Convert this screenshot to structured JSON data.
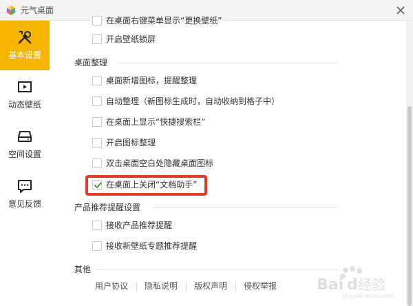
{
  "window": {
    "title": "元气桌面",
    "close_label": "×"
  },
  "sidebar": {
    "items": [
      {
        "label": "基本设置",
        "icon": "tools-icon",
        "active": true
      },
      {
        "label": "动态壁纸",
        "icon": "play-icon",
        "active": false
      },
      {
        "label": "空间设置",
        "icon": "disk-icon",
        "active": false
      },
      {
        "label": "意见反馈",
        "icon": "chat-icon",
        "active": false
      }
    ]
  },
  "main": {
    "top_partial_option": "在桌面右键菜单显示“更换壁纸”",
    "top_option": {
      "label": "开启壁纸锁屏",
      "checked": false
    },
    "sections": [
      {
        "title": "桌面整理",
        "options": [
          {
            "label": "桌面新增图标，提醒整理",
            "checked": false
          },
          {
            "label": "自动整理（新图标生成时，自动收纳到格子中）",
            "checked": false
          },
          {
            "label": "在桌面上显示“快捷搜索栏”",
            "checked": false
          },
          {
            "label": "开启图标整理",
            "checked": false
          },
          {
            "label": "双击桌面空白处隐藏桌面图标",
            "checked": false
          },
          {
            "label": "在桌面上关闭“文档助手”",
            "checked": true
          }
        ]
      },
      {
        "title": "产品推荐提醒设置",
        "options": [
          {
            "label": "接收产品推荐提醒",
            "checked": false
          },
          {
            "label": "接收新壁纸专题推荐提醒",
            "checked": false
          }
        ]
      },
      {
        "title": "其他",
        "links": [
          "用户协议",
          "隐私说明",
          "版权声明",
          "侵权举报"
        ]
      }
    ]
  },
  "watermark": {
    "text": "Bai 经验",
    "subtext": "jingyan.baidu.com"
  },
  "colors": {
    "accent": "#f5b400",
    "highlight": "#e53a26",
    "check": "#3aa13a"
  }
}
